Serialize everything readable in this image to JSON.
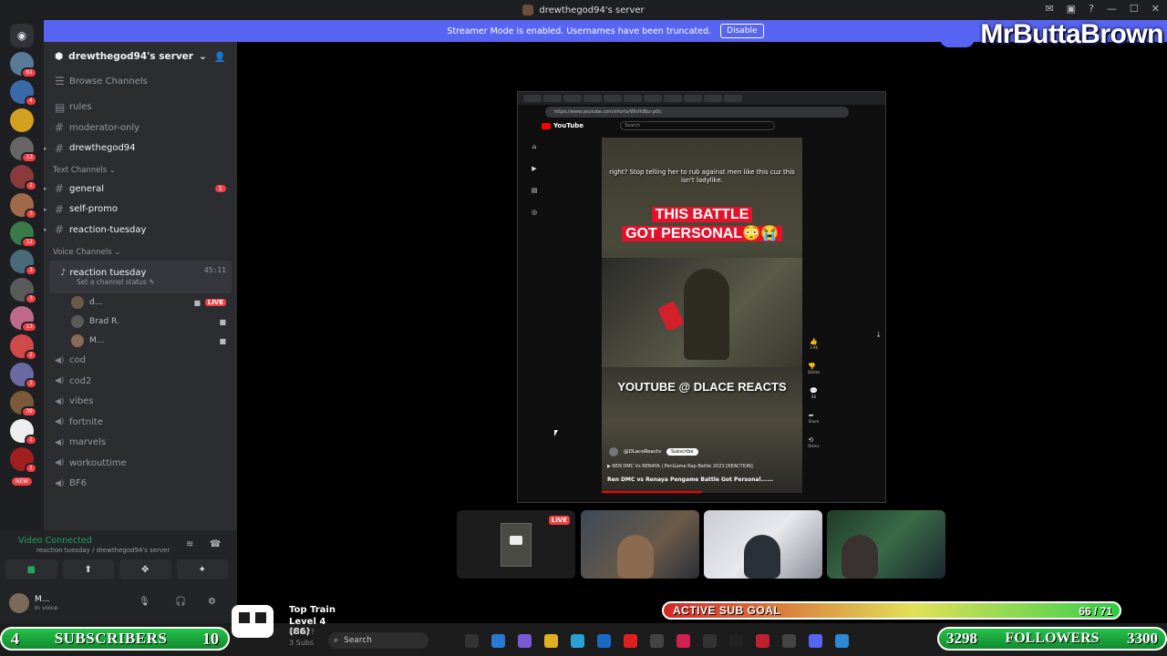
{
  "window": {
    "title": "drewthegod94's server"
  },
  "streamer_mode": {
    "message": "Streamer Mode is enabled. Usernames have been truncated.",
    "disable_label": "Disable"
  },
  "overlay_brand": "MrButtaBrown",
  "rail": {
    "badges": [
      "61",
      "4",
      "",
      "13",
      "2",
      "3",
      "12",
      "3",
      "3",
      "13",
      "2",
      "2",
      "39",
      "1",
      "1"
    ],
    "new_label": "NEW"
  },
  "server": {
    "name": "drewthegod94's server",
    "browse": "Browse Channels",
    "top_channels": [
      "rules",
      "moderator-only",
      "drewthegod94"
    ],
    "text_category": "Text Channels",
    "text_channels": [
      {
        "name": "general",
        "count": "1"
      },
      {
        "name": "self-promo"
      },
      {
        "name": "reaction-tuesday"
      }
    ],
    "voice_category": "Voice Channels",
    "active_voice": {
      "name": "reaction tuesday",
      "timer": "45:11",
      "status": "Set a channel status"
    },
    "voice_users": [
      {
        "name": "d...",
        "live": "LIVE"
      },
      {
        "name": "Brad R."
      },
      {
        "name": "M..."
      }
    ],
    "voice_channels": [
      "cod",
      "cod2",
      "vibes",
      "fortnite",
      "marvels",
      "workouttime",
      "BF6"
    ]
  },
  "voice_panel": {
    "status": "Video Connected",
    "location": "reaction tuesday / drewthegod94's server"
  },
  "user_panel": {
    "name": "M...",
    "status": "In voice"
  },
  "stream": {
    "url": "https://www.youtube.com/shorts/Wlsfh8bz-pOc",
    "search_placeholder": "Search",
    "caption": "right? Stop telling her to rub against men like this cuz this isn't ladylike.",
    "headline_1": "THIS BATTLE",
    "headline_2": "GOT PERSONAL😳😭",
    "channel_tag": "YOUTUBE @ DLACE REACTS",
    "handle": "@DLaceReacts",
    "subscribe": "Subscribe",
    "desc": "▶ REN DMC Vs RENAYA | PenGame Rap Battle 2023 [REACTION]",
    "title": "Ren DMC vs Renaya Pengame Battle Got Personal......",
    "actions": [
      "3.9K",
      "Dislike",
      "88",
      "Share",
      "Remix"
    ],
    "side": [
      "Home",
      "Shorts",
      "Subscriptions",
      "You"
    ]
  },
  "tiles": {
    "live_label": "LIVE"
  },
  "taskbar": {
    "search": "Search"
  },
  "overlays": {
    "subs_label": "SUBSCRIBERS",
    "subs_count": "4",
    "subs_goal": "10",
    "subgoal_label": "ACTIVE SUB GOAL",
    "subgoal_value": "66 / 71",
    "subgoal_progress": 0.93,
    "followers_label": "FOLLOWERS",
    "followers_count": "3298",
    "followers_goal": "3300",
    "train_title": "Top Train",
    "train_level": "Level 4 (86)",
    "train_user": "Hitta??",
    "train_subs": "3 Subs"
  },
  "colors": {
    "discord_blurple": "#5865f2",
    "live_red": "#f23f43",
    "connected_green": "#23a55a"
  }
}
